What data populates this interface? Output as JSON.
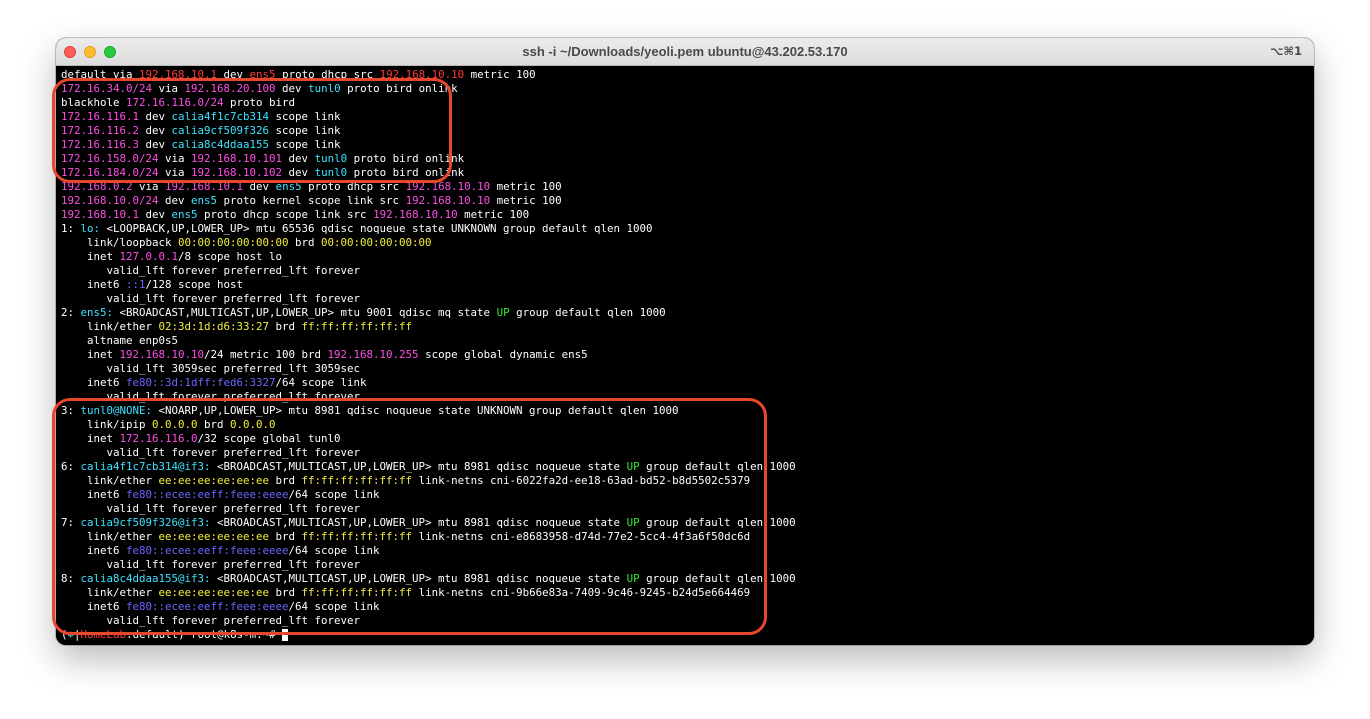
{
  "window": {
    "title": "ssh -i ~/Downloads/yeoli.pem ubuntu@43.202.53.170",
    "shortcut": "⌥⌘1"
  },
  "colors": {
    "ip": "#ff4fe6",
    "dev": "#3ee2ff",
    "mac": "#f3f03b",
    "up": "#39e83a",
    "ipv6": "#6a66ff",
    "callout": "#e8462d"
  },
  "terminal": {
    "lines": [
      [
        [
          "default via ",
          ""
        ],
        [
          "192.168.10.1",
          "red"
        ],
        [
          " dev ",
          ""
        ],
        [
          "ens5",
          "red"
        ],
        [
          " proto dhcp src ",
          ""
        ],
        [
          "192.168.10.10",
          "red"
        ],
        [
          " metric 100",
          ""
        ]
      ],
      [
        [
          "172.16.34.0/24",
          "ip"
        ],
        [
          " via ",
          ""
        ],
        [
          "192.168.20.100",
          "ip"
        ],
        [
          " dev ",
          ""
        ],
        [
          "tunl0",
          "dev"
        ],
        [
          " proto bird onlink",
          ""
        ]
      ],
      [
        [
          "blackhole ",
          ""
        ],
        [
          "172.16.116.0/24",
          "ip"
        ],
        [
          " proto bird",
          ""
        ]
      ],
      [
        [
          "172.16.116.1",
          "ip"
        ],
        [
          " dev ",
          ""
        ],
        [
          "calia4f1c7cb314",
          "dev"
        ],
        [
          " scope link",
          ""
        ]
      ],
      [
        [
          "172.16.116.2",
          "ip"
        ],
        [
          " dev ",
          ""
        ],
        [
          "calia9cf509f326",
          "dev"
        ],
        [
          " scope link",
          ""
        ]
      ],
      [
        [
          "172.16.116.3",
          "ip"
        ],
        [
          " dev ",
          ""
        ],
        [
          "calia8c4ddaa155",
          "dev"
        ],
        [
          " scope link",
          ""
        ]
      ],
      [
        [
          "172.16.158.0/24",
          "ip"
        ],
        [
          " via ",
          ""
        ],
        [
          "192.168.10.101",
          "ip"
        ],
        [
          " dev ",
          ""
        ],
        [
          "tunl0",
          "dev"
        ],
        [
          " proto bird onlink",
          ""
        ]
      ],
      [
        [
          "172.16.184.0/24",
          "ip"
        ],
        [
          " via ",
          ""
        ],
        [
          "192.168.10.102",
          "ip"
        ],
        [
          " dev ",
          ""
        ],
        [
          "tunl0",
          "dev"
        ],
        [
          " proto bird onlink",
          ""
        ]
      ],
      [
        [
          "192.168.0.2",
          "ip"
        ],
        [
          " via ",
          ""
        ],
        [
          "192.168.10.1",
          "ip"
        ],
        [
          " dev ",
          ""
        ],
        [
          "ens5",
          "dev"
        ],
        [
          " proto dhcp src ",
          ""
        ],
        [
          "192.168.10.10",
          "ip"
        ],
        [
          " metric 100",
          ""
        ]
      ],
      [
        [
          "192.168.10.0/24",
          "ip"
        ],
        [
          " dev ",
          ""
        ],
        [
          "ens5",
          "dev"
        ],
        [
          " proto kernel scope link src ",
          ""
        ],
        [
          "192.168.10.10",
          "ip"
        ],
        [
          " metric 100",
          ""
        ]
      ],
      [
        [
          "192.168.10.1",
          "ip"
        ],
        [
          " dev ",
          ""
        ],
        [
          "ens5",
          "dev"
        ],
        [
          " proto dhcp scope link src ",
          ""
        ],
        [
          "192.168.10.10",
          "ip"
        ],
        [
          " metric 100",
          ""
        ]
      ],
      [
        [
          "1: ",
          ""
        ],
        [
          "lo:",
          "dev"
        ],
        [
          " <LOOPBACK,UP,LOWER_UP> mtu 65536 qdisc noqueue state UNKNOWN group default qlen 1000",
          ""
        ]
      ],
      [
        [
          "    link/loopback ",
          ""
        ],
        [
          "00:00:00:00:00:00",
          "mac"
        ],
        [
          " brd ",
          ""
        ],
        [
          "00:00:00:00:00:00",
          "mac"
        ]
      ],
      [
        [
          "    inet ",
          ""
        ],
        [
          "127.0.0.1",
          "ip"
        ],
        [
          "/8 scope host lo",
          ""
        ]
      ],
      [
        [
          "       valid_lft forever preferred_lft forever",
          ""
        ]
      ],
      [
        [
          "    inet6 ",
          ""
        ],
        [
          "::1",
          "v6"
        ],
        [
          "/128 scope host",
          ""
        ]
      ],
      [
        [
          "       valid_lft forever preferred_lft forever",
          ""
        ]
      ],
      [
        [
          "2: ",
          ""
        ],
        [
          "ens5:",
          "dev"
        ],
        [
          " <BROADCAST,MULTICAST,UP,LOWER_UP> mtu 9001 qdisc mq state ",
          ""
        ],
        [
          "UP",
          "up"
        ],
        [
          " group default qlen 1000",
          ""
        ]
      ],
      [
        [
          "    link/ether ",
          ""
        ],
        [
          "02:3d:1d:d6:33:27",
          "mac"
        ],
        [
          " brd ",
          ""
        ],
        [
          "ff:ff:ff:ff:ff:ff",
          "mac"
        ]
      ],
      [
        [
          "    altname enp0s5",
          ""
        ]
      ],
      [
        [
          "    inet ",
          ""
        ],
        [
          "192.168.10.10",
          "ip"
        ],
        [
          "/24 metric 100 brd ",
          ""
        ],
        [
          "192.168.10.255",
          "ip"
        ],
        [
          " scope global dynamic ens5",
          ""
        ]
      ],
      [
        [
          "       valid_lft 3059sec preferred_lft 3059sec",
          ""
        ]
      ],
      [
        [
          "    inet6 ",
          ""
        ],
        [
          "fe80::3d:1dff:fed6:3327",
          "v6"
        ],
        [
          "/64 scope link",
          ""
        ]
      ],
      [
        [
          "       valid_lft forever preferred_lft forever",
          ""
        ]
      ],
      [
        [
          "3: ",
          ""
        ],
        [
          "tunl0@NONE:",
          "dev"
        ],
        [
          " <NOARP,UP,LOWER_UP> mtu 8981 qdisc noqueue state UNKNOWN group default qlen 1000",
          ""
        ]
      ],
      [
        [
          "    link/ipip ",
          ""
        ],
        [
          "0.0.0.0",
          "mac"
        ],
        [
          " brd ",
          ""
        ],
        [
          "0.0.0.0",
          "mac"
        ]
      ],
      [
        [
          "    inet ",
          ""
        ],
        [
          "172.16.116.0",
          "ip"
        ],
        [
          "/32 scope global tunl0",
          ""
        ]
      ],
      [
        [
          "       valid_lft forever preferred_lft forever",
          ""
        ]
      ],
      [
        [
          "6: ",
          ""
        ],
        [
          "calia4f1c7cb314@if3:",
          "dev"
        ],
        [
          " <BROADCAST,MULTICAST,UP,LOWER_UP> mtu 8981 qdisc noqueue state ",
          ""
        ],
        [
          "UP",
          "up"
        ],
        [
          " group default qlen 1000",
          ""
        ]
      ],
      [
        [
          "    link/ether ",
          ""
        ],
        [
          "ee:ee:ee:ee:ee:ee",
          "mac"
        ],
        [
          " brd ",
          ""
        ],
        [
          "ff:ff:ff:ff:ff:ff",
          "mac"
        ],
        [
          " link-netns cni-6022fa2d-ee18-63ad-bd52-b8d5502c5379",
          ""
        ]
      ],
      [
        [
          "    inet6 ",
          ""
        ],
        [
          "fe80::ecee:eeff:feee:eeee",
          "v6"
        ],
        [
          "/64 scope link",
          ""
        ]
      ],
      [
        [
          "       valid_lft forever preferred_lft forever",
          ""
        ]
      ],
      [
        [
          "7: ",
          ""
        ],
        [
          "calia9cf509f326@if3:",
          "dev"
        ],
        [
          " <BROADCAST,MULTICAST,UP,LOWER_UP> mtu 8981 qdisc noqueue state ",
          ""
        ],
        [
          "UP",
          "up"
        ],
        [
          " group default qlen 1000",
          ""
        ]
      ],
      [
        [
          "    link/ether ",
          ""
        ],
        [
          "ee:ee:ee:ee:ee:ee",
          "mac"
        ],
        [
          " brd ",
          ""
        ],
        [
          "ff:ff:ff:ff:ff:ff",
          "mac"
        ],
        [
          " link-netns cni-e8683958-d74d-77e2-5cc4-4f3a6f50dc6d",
          ""
        ]
      ],
      [
        [
          "    inet6 ",
          ""
        ],
        [
          "fe80::ecee:eeff:feee:eeee",
          "v6"
        ],
        [
          "/64 scope link",
          ""
        ]
      ],
      [
        [
          "       valid_lft forever preferred_lft forever",
          ""
        ]
      ],
      [
        [
          "8: ",
          ""
        ],
        [
          "calia8c4ddaa155@if3:",
          "dev"
        ],
        [
          " <BROADCAST,MULTICAST,UP,LOWER_UP> mtu 8981 qdisc noqueue state ",
          ""
        ],
        [
          "UP",
          "up"
        ],
        [
          " group default qlen 1000",
          ""
        ]
      ],
      [
        [
          "    link/ether ",
          ""
        ],
        [
          "ee:ee:ee:ee:ee:ee",
          "mac"
        ],
        [
          " brd ",
          ""
        ],
        [
          "ff:ff:ff:ff:ff:ff",
          "mac"
        ],
        [
          " link-netns cni-9b66e83a-7409-9c46-9245-b24d5e664469",
          ""
        ]
      ],
      [
        [
          "    inet6 ",
          ""
        ],
        [
          "fe80::ecee:eeff:feee:eeee",
          "v6"
        ],
        [
          "/64 scope link",
          ""
        ]
      ],
      [
        [
          "       valid_lft forever preferred_lft forever",
          ""
        ]
      ],
      [
        [
          "(",
          ""
        ],
        [
          "⎈",
          "dev"
        ],
        [
          "|",
          ""
        ],
        [
          "HomeLab",
          "red"
        ],
        [
          ":default) root@k8s-m:~# ",
          ""
        ]
      ]
    ]
  }
}
